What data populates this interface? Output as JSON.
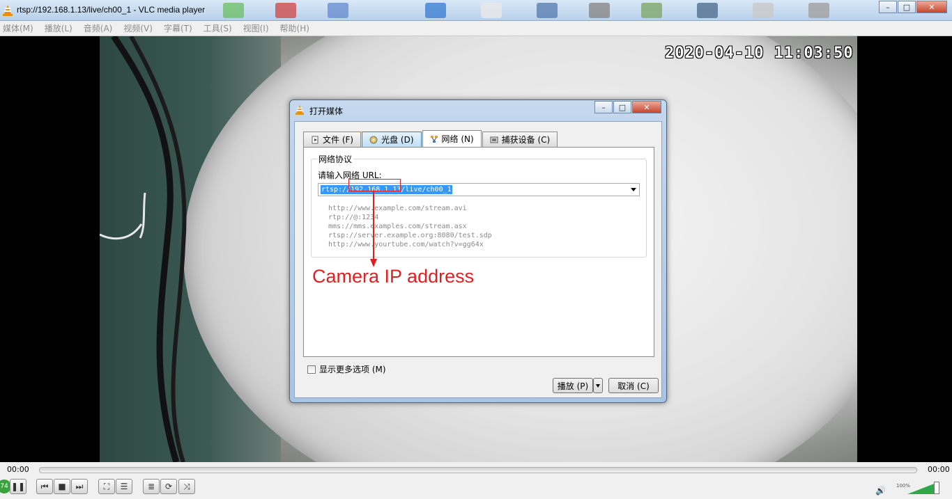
{
  "window": {
    "title": "rtsp://192.168.1.13/live/ch00_1 - VLC media player",
    "buttons": {
      "minimize": "–",
      "maximize": "□",
      "close": "✕"
    }
  },
  "menu": [
    "媒体(M)",
    "播放(L)",
    "音频(A)",
    "视频(V)",
    "字幕(T)",
    "工具(S)",
    "视图(I)",
    "帮助(H)"
  ],
  "video": {
    "osd_timestamp": "2020-04-10 11:03:50"
  },
  "dialog": {
    "title": "打开媒体",
    "tabs": [
      {
        "label": "文件 (F)",
        "icon": "file-icon"
      },
      {
        "label": "光盘 (D)",
        "icon": "disc-icon"
      },
      {
        "label": "网络 (N)",
        "icon": "network-icon"
      },
      {
        "label": "捕获设备 (C)",
        "icon": "capture-device-icon"
      }
    ],
    "active_tab": "网络 (N)",
    "group_legend": "网络协议",
    "url_prompt": "请输入网络 URL:",
    "url_value": "rtsp://192.168.1.13/live/ch00_1",
    "examples": [
      "http://www.example.com/stream.avi",
      "rtp://@:1234",
      "mms://mms.examples.com/stream.asx",
      "rtsp://server.example.org:8080/test.sdp",
      "http://www.yourtube.com/watch?v=gg64x"
    ],
    "show_more_options": "显示更多选项 (M)",
    "play_button": "播放 (P)",
    "cancel_button": "取消 (C)"
  },
  "annotation": {
    "text": "Camera IP address",
    "color": "#e02020"
  },
  "controls": {
    "elapsed": "00:00",
    "total": "00:00",
    "volume": "100%",
    "badge": "74",
    "accent": "#2ea84a"
  }
}
